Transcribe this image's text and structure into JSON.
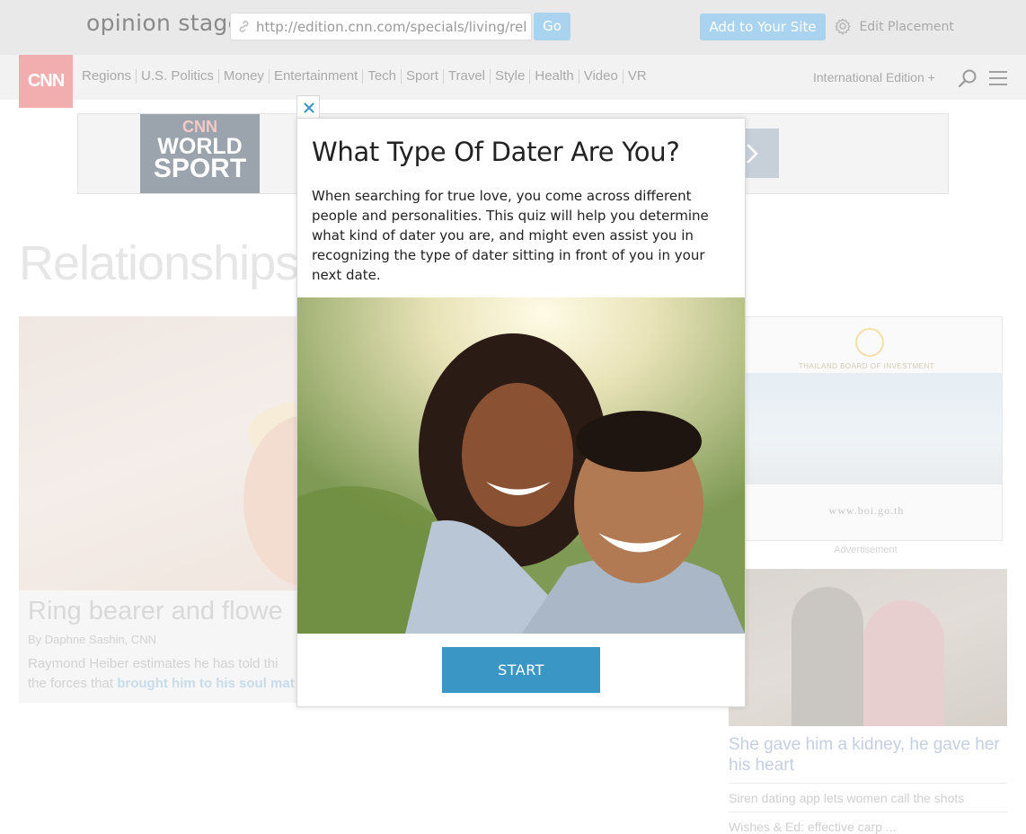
{
  "opinion_stage": {
    "logo": "opinion stage",
    "url_value": "http://edition.cnn.com/specials/living/rel",
    "go_label": "Go",
    "add_label": "Add to Your Site",
    "edit_label": "Edit Placement"
  },
  "cnn": {
    "logo": "CNN",
    "nav": [
      "Regions",
      "U.S. Politics",
      "Money",
      "Entertainment",
      "Tech",
      "Sport",
      "Travel",
      "Style",
      "Health",
      "Video",
      "VR"
    ],
    "edition": "International Edition +",
    "banner": {
      "cnn": "CNN",
      "world": "WORLD",
      "sport": "SPORT"
    }
  },
  "page": {
    "title": "Relationships",
    "card": {
      "title": "Ring bearer and flowe",
      "byline": "By Daphne Sashin, CNN",
      "desc_prefix": "Raymond Heiber estimates he has told thi",
      "desc_mid": "the forces that",
      "desc_link": "brought him to his soul mat"
    },
    "ad": {
      "org": "THAILAND BOARD OF INVESTMENT",
      "url": "www.boi.go.th",
      "label": "Advertisement"
    },
    "side": {
      "title": "She gave him a kidney, he gave her his heart",
      "links": [
        "Siren dating app lets women call the shots",
        "Wishes & Ed: effective carp ..."
      ]
    }
  },
  "quiz": {
    "title": "What Type Of Dater Are You?",
    "description": "When searching for true love, you come across different people and personalities. This quiz will help you determine what kind of dater you are, and might even assist you in recognizing the type of dater sitting in front of you in your next date.",
    "start_label": "START"
  }
}
